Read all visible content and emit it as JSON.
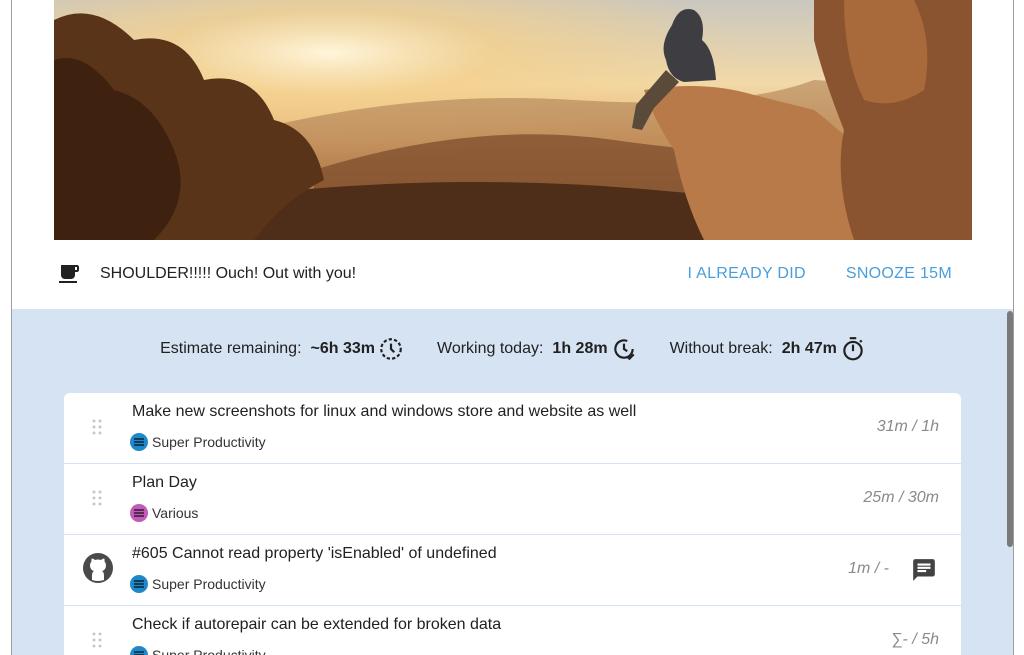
{
  "banner": {
    "message": "SHOULDER!!!!! Ouch! Out with you!",
    "already_did_label": "I ALREADY DID",
    "snooze_label": "SNOOZE 15M",
    "icon": "coffee-icon"
  },
  "metrics": {
    "estimate_label": "Estimate remaining:",
    "estimate_value": "~6h 33m",
    "working_label": "Working today:",
    "working_value": "1h 28m",
    "break_label": "Without break:",
    "break_value": "2h 47m"
  },
  "tasks": [
    {
      "title": "Make new screenshots for linux and windows store and website as well",
      "project": "Super Productivity",
      "time": "31m / 1h",
      "project_color": "#1e88c8"
    },
    {
      "title": "Plan Day",
      "project": "Various",
      "time": "25m / 30m",
      "project_color": "#c05bb8"
    },
    {
      "title": "#605 Cannot read property 'isEnabled' of undefined",
      "project": "Super Productivity",
      "time": "1m / -",
      "project_color": "#1e88c8",
      "icon": "github-icon"
    },
    {
      "title": "Check if autorepair can be extended for broken data",
      "project": "Super Productivity",
      "time": "∑- / 5h",
      "project_color": "#1e88c8"
    }
  ],
  "colors": {
    "accent": "#4a9edb",
    "work_bg": "#d6e3f3"
  }
}
